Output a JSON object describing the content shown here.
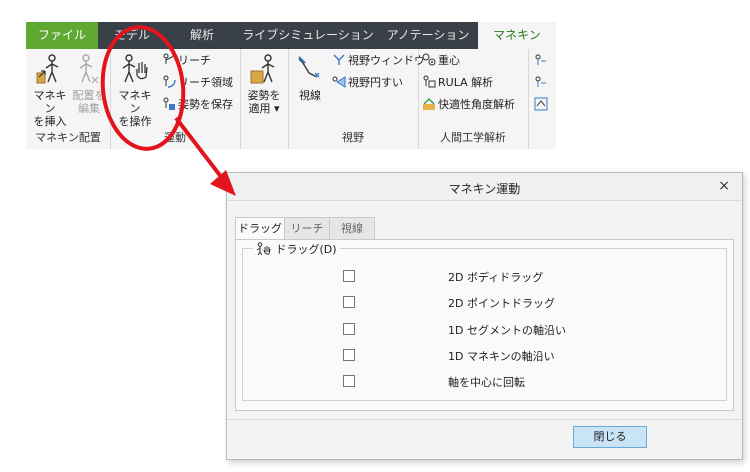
{
  "ribbon": {
    "tabs": [
      "ファイル",
      "モデル",
      "解析",
      "ライブシミュレーション",
      "アノテーション",
      "マネキン"
    ],
    "groups": {
      "placement": {
        "label": "マネキン配置",
        "insert_line1": "マネキン",
        "insert_line2": "を挿入",
        "place_line1": "配置を",
        "place_line2": "編集"
      },
      "motion": {
        "label": "運動",
        "operate_line1": "マネキン",
        "operate_line2": "を操作",
        "reach": "リーチ",
        "reach_area": "リーチ領域",
        "save_pose": "姿勢を保存",
        "apply_pose_line1": "姿勢を",
        "apply_pose_line2": "適用 ▾"
      },
      "view": {
        "label": "視野",
        "sight_line": "視線",
        "view_window": "視野ウィンドウ",
        "view_cone": "視野円すい"
      },
      "ergonomics": {
        "label": "人間工学解析",
        "center_of_gravity": "重心",
        "rula": "RULA 解析",
        "comfort_angle": "快適性角度解析"
      }
    }
  },
  "dialog": {
    "title": "マネキン運動",
    "close_icon_glyph": "×",
    "tabs": [
      "ドラッグ",
      "リーチ",
      "視線"
    ],
    "group_label": "ドラッグ(D)",
    "options": [
      {
        "label": "2D ボディドラッグ",
        "checked": false
      },
      {
        "label": "2D ポイントドラッグ",
        "checked": false
      },
      {
        "label": "1D セグメントの軸沿い",
        "checked": false
      },
      {
        "label": "1D マネキンの軸沿い",
        "checked": false
      },
      {
        "label": "軸を中心に回転",
        "checked": false
      }
    ],
    "close_button": "閉じる"
  },
  "colors": {
    "file_tab": "#5fa832",
    "tabbar": "#3a4048",
    "active_tab_text": "#2a7a1a",
    "annotation": "#e3141b",
    "close_button_bg": "#c9e4f6",
    "close_button_border": "#6aa9d8"
  }
}
